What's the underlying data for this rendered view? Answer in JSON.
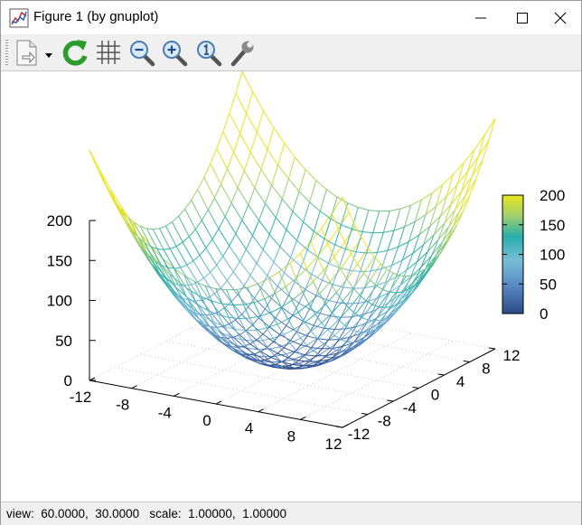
{
  "window": {
    "title": "Figure 1 (by gnuplot)"
  },
  "titlebar_buttons": [
    {
      "name": "minimize-button",
      "icon": "minimize-icon"
    },
    {
      "name": "maximize-button",
      "icon": "maximize-icon"
    },
    {
      "name": "close-button",
      "icon": "close-icon"
    }
  ],
  "toolbar": {
    "items": [
      {
        "name": "export-button",
        "icon": "export-document-icon"
      },
      {
        "name": "export-menu-button",
        "icon": "dropdown-arrow-icon"
      },
      {
        "name": "replot-button",
        "icon": "refresh-icon"
      },
      {
        "name": "grid-button",
        "icon": "grid-icon"
      },
      {
        "name": "zoom-previous-button",
        "icon": "zoom-out-icon"
      },
      {
        "name": "zoom-next-button",
        "icon": "zoom-in-icon"
      },
      {
        "name": "autoscale-button",
        "icon": "zoom-reset-icon"
      },
      {
        "name": "options-button",
        "icon": "wrench-icon"
      }
    ]
  },
  "status": {
    "text": "view:  60.0000,  30.0000   scale:  1.00000,  1.00000"
  },
  "chart_data": {
    "type": "surface",
    "function": "x^2 + y^2",
    "x_range": [
      -12,
      12
    ],
    "y_range": [
      -12,
      12
    ],
    "z_range": [
      0,
      200
    ],
    "x_ticks": [
      "-12",
      "-8",
      "-4",
      "0",
      "4",
      "8",
      "12"
    ],
    "y_ticks": [
      "-12",
      "-8",
      "-4",
      "0",
      "4",
      "8",
      "12"
    ],
    "z_ticks": [
      "0",
      "50",
      "100",
      "150",
      "200"
    ],
    "colorbar_ticks": [
      "0",
      "50",
      "100",
      "150",
      "200"
    ],
    "colorbar_range": [
      0,
      200
    ],
    "colormap": [
      "#2b4a88",
      "#5a8cc4",
      "#79bdd6",
      "#26aeaa",
      "#9fcf70",
      "#e8e51e"
    ],
    "grid": true,
    "view": [
      60,
      30
    ]
  }
}
